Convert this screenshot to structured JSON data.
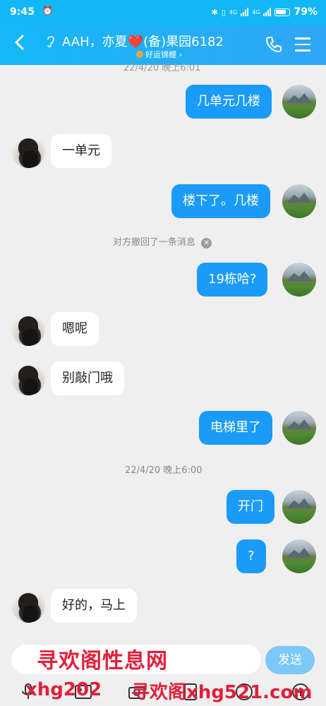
{
  "status_bar": {
    "time": "9:45",
    "battery": "79%",
    "net1": "4G",
    "net2": "4G"
  },
  "header": {
    "back_icon": "chevron-left",
    "title_prefix": "AAH，亦夏",
    "title_heart": "❤️",
    "title_suffix": "(备)果园6182",
    "subtitle": "好运锦鲤",
    "subtitle_arrow": "›"
  },
  "partial_timestamp": "22/4/20 晚上6:01",
  "messages": [
    {
      "side": "out",
      "text": "几单元几楼"
    },
    {
      "side": "in",
      "text": "一单元"
    },
    {
      "side": "out",
      "text": "楼下了。几楼"
    },
    {
      "side": "system",
      "text": "对方撤回了一条消息"
    },
    {
      "side": "out",
      "text": "19栋哈?"
    },
    {
      "side": "in",
      "text": "嗯呢"
    },
    {
      "side": "in",
      "text": "别敲门哦"
    },
    {
      "side": "out",
      "text": "电梯里了"
    },
    {
      "side": "time",
      "text": "22/4/20 晚上6:00"
    },
    {
      "side": "out",
      "text": "开门"
    },
    {
      "side": "out",
      "text": "?"
    },
    {
      "side": "in",
      "text": "好的，马上"
    }
  ],
  "input": {
    "placeholder": "",
    "value": ""
  },
  "send_label": "发送",
  "watermark": {
    "line1": "寻欢阁性息网",
    "line2a": "xhg202",
    "line2b": "寻欢阁xhg521.com"
  },
  "colors": {
    "accent": "#12b7f5",
    "bubble_out": "#1a9bf7",
    "bubble_in": "#ffffff",
    "send": "#7cc8f8",
    "watermark": "#e0203b"
  }
}
